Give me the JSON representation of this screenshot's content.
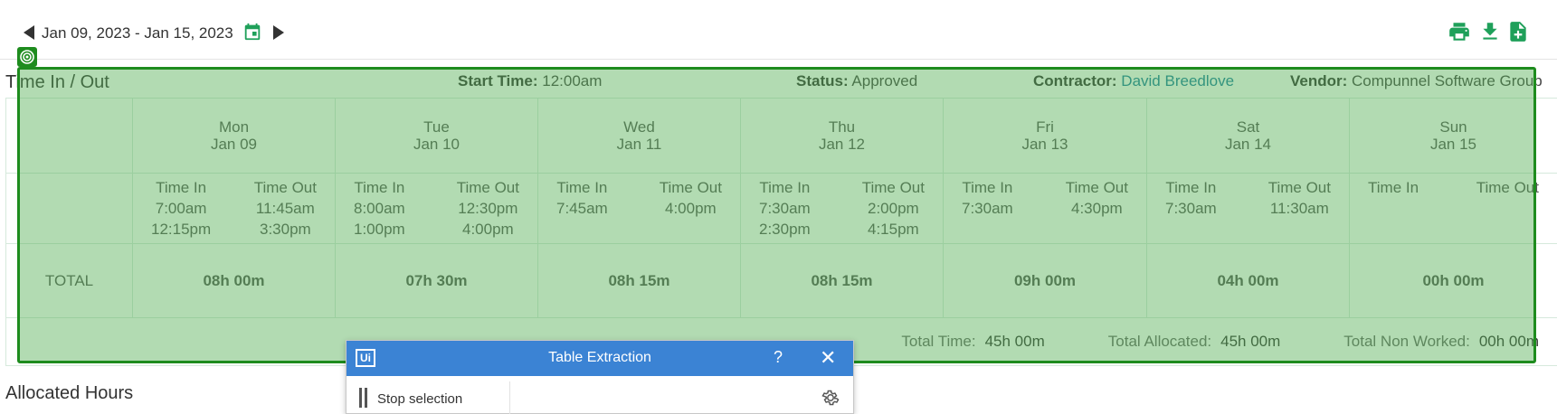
{
  "header": {
    "date_range": "Jan 09, 2023 - Jan 15, 2023",
    "icons": [
      "prev-week-icon",
      "calendar-icon",
      "next-week-icon",
      "print-icon",
      "download-icon",
      "export-icon"
    ]
  },
  "timesheet": {
    "section_title": "Time In / Out",
    "start_time_label": "Start Time:",
    "start_time_value": "12:00am",
    "status_label": "Status:",
    "status_value": "Approved",
    "contractor_label": "Contractor:",
    "contractor_value": "David Breedlove",
    "vendor_label": "Vendor:",
    "vendor_value": "Compunnel Software Group",
    "time_in_header": "Time In",
    "time_out_header": "Time Out",
    "total_label": "TOTAL",
    "days": [
      {
        "name": "Mon",
        "date": "Jan 09",
        "in": [
          "7:00am",
          "12:15pm"
        ],
        "out": [
          "11:45am",
          "3:30pm"
        ],
        "total": "08h 00m"
      },
      {
        "name": "Tue",
        "date": "Jan 10",
        "in": [
          "8:00am",
          "1:00pm"
        ],
        "out": [
          "12:30pm",
          "4:00pm"
        ],
        "total": "07h 30m"
      },
      {
        "name": "Wed",
        "date": "Jan 11",
        "in": [
          "7:45am"
        ],
        "out": [
          "4:00pm"
        ],
        "total": "08h 15m"
      },
      {
        "name": "Thu",
        "date": "Jan 12",
        "in": [
          "7:30am",
          "2:30pm"
        ],
        "out": [
          "2:00pm",
          "4:15pm"
        ],
        "total": "08h 15m"
      },
      {
        "name": "Fri",
        "date": "Jan 13",
        "in": [
          "7:30am"
        ],
        "out": [
          "4:30pm"
        ],
        "total": "09h 00m"
      },
      {
        "name": "Sat",
        "date": "Jan 14",
        "in": [
          "7:30am"
        ],
        "out": [
          "11:30am"
        ],
        "total": "04h 00m"
      },
      {
        "name": "Sun",
        "date": "Jan 15",
        "in": [],
        "out": [],
        "total": "00h 00m"
      }
    ],
    "summary": {
      "total_time_label": "Total Time:",
      "total_time_value": "45h 00m",
      "total_allocated_label": "Total Allocated:",
      "total_allocated_value": "45h 00m",
      "total_non_worked_label": "Total Non Worked:",
      "total_non_worked_value": "00h 00m"
    }
  },
  "allocated": {
    "section_title": "Allocated Hours"
  },
  "extraction_dialog": {
    "logo": "Ui",
    "title": "Table Extraction",
    "help": "?",
    "close": "✕",
    "stop_label": "Stop selection"
  },
  "colors": {
    "accent_green": "#1fa05a",
    "selection_border": "#1e8c1e",
    "dialog_header": "#3b83d4",
    "link": "#1a7fa0"
  }
}
